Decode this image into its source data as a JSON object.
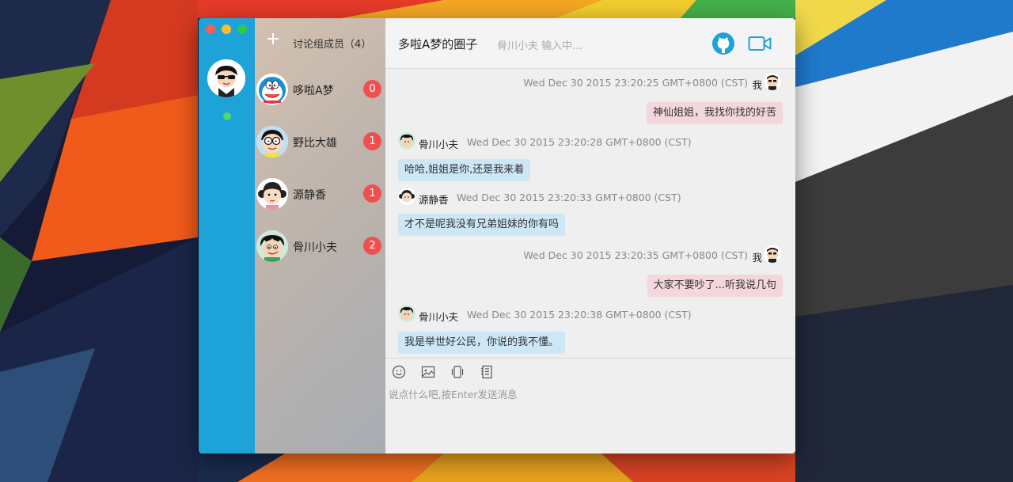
{
  "window": {
    "group_title": "多啦A梦的圈子",
    "typing_status": "骨川小夫 输入中..."
  },
  "members_panel": {
    "title": "讨论组成员（4）",
    "items": [
      {
        "name": "哆啦A梦",
        "badge": "0"
      },
      {
        "name": "野比大雄",
        "badge": "1"
      },
      {
        "name": "源静香",
        "badge": "1"
      },
      {
        "name": "骨川小夫",
        "badge": "2"
      }
    ]
  },
  "messages": [
    {
      "sender": "我",
      "time": "Wed Dec 30 2015 23:20:25 GMT+0800 (CST)",
      "text": "神仙姐姐，我找你找的好苦",
      "mine": true
    },
    {
      "sender": "骨川小夫",
      "time": "Wed Dec 30 2015 23:20:28 GMT+0800 (CST)",
      "text": "哈哈,姐姐是你,还是我来着",
      "mine": false
    },
    {
      "sender": "源静香",
      "time": "Wed Dec 30 2015 23:20:33 GMT+0800 (CST)",
      "text": "才不是呢我没有兄弟姐妹的你有吗",
      "mine": false
    },
    {
      "sender": "我",
      "time": "Wed Dec 30 2015 23:20:35 GMT+0800 (CST)",
      "text": "大家不要吵了...听我说几句",
      "mine": true
    },
    {
      "sender": "骨川小夫",
      "time": "Wed Dec 30 2015 23:20:38 GMT+0800 (CST)",
      "text": "我是举世好公民，你说的我不懂。",
      "mine": false
    }
  ],
  "composer": {
    "placeholder": "说点什么吧,按Enter发送消息"
  },
  "icons": {
    "add": "plus-icon",
    "github": "github-icon",
    "video": "video-camera-icon",
    "toolbar": [
      "emoji-icon",
      "image-icon",
      "shake-icon",
      "notes-icon"
    ]
  },
  "colors": {
    "rail": "#1ea3d9",
    "badge": "#ef4f4f",
    "online": "#4cd964",
    "bubble_mine": "#f4d6dc",
    "bubble_theirs": "#cde7f6"
  }
}
